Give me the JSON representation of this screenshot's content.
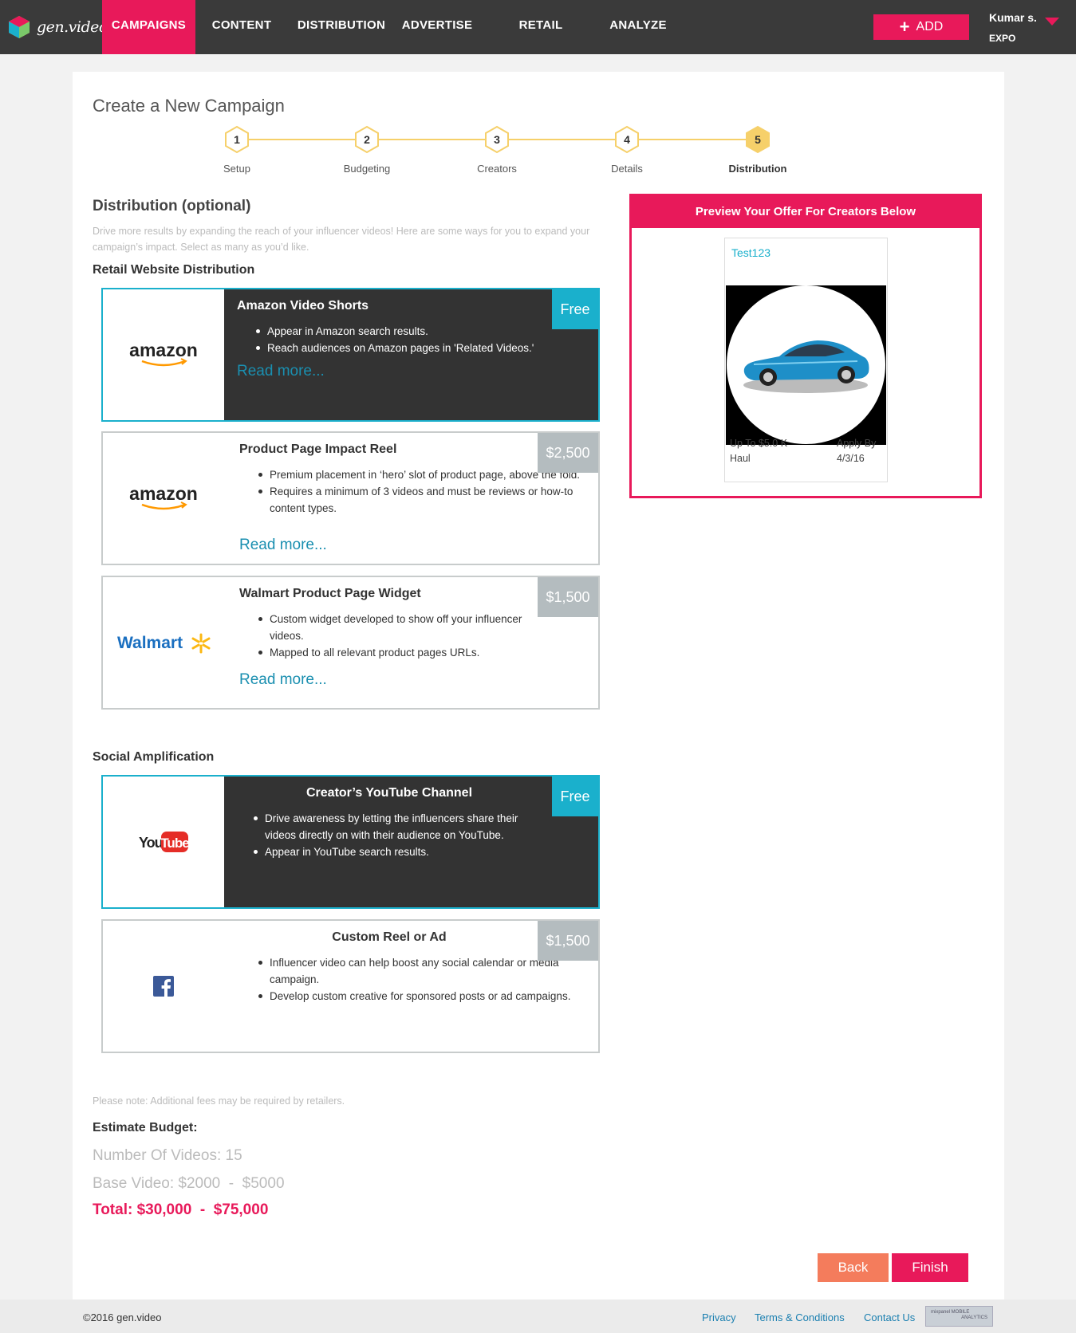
{
  "nav": {
    "logo_text": "gen.video",
    "items": [
      "CAMPAIGNS",
      "CONTENT",
      "DISTRIBUTION",
      "ADVERTISE",
      "RETAIL",
      "ANALYZE"
    ],
    "add_label": "ADD",
    "user_name": "Kumar s.",
    "user_org": "EXPO",
    "accent_color": "#e8195a"
  },
  "page": {
    "title": "Create a New Campaign",
    "steps": [
      {
        "num": "1",
        "label": "Setup"
      },
      {
        "num": "2",
        "label": "Budgeting"
      },
      {
        "num": "3",
        "label": "Creators"
      },
      {
        "num": "4",
        "label": "Details"
      },
      {
        "num": "5",
        "label": "Distribution"
      }
    ],
    "current_step": 5
  },
  "distribution": {
    "title": "Distribution (optional)",
    "intro": "Drive more results by expanding the reach of your influencer videos! Here are some ways for you to expand your campaign’s impact. Select as many as you’d like.",
    "retail_heading": "Retail Website Distribution",
    "social_heading": "Social Amplification",
    "cards": [
      {
        "logo": "amazon",
        "title": "Amazon Video Shorts",
        "price": "Free",
        "selected": true,
        "bullets": [
          "Appear in Amazon search results.",
          "Reach audiences on Amazon pages in 'Related Videos.'"
        ],
        "readmore": "Read more..."
      },
      {
        "logo": "amazon",
        "title": "Product Page Impact Reel",
        "price": "$2,500",
        "selected": false,
        "bullets": [
          "Premium placement in ‘hero’ slot of product page, above the fold.",
          "Requires a minimum of 3 videos and must be reviews or how-to content types."
        ],
        "readmore": "Read more..."
      },
      {
        "logo": "Walmart",
        "title": "Walmart Product Page Widget",
        "price": "$1,500",
        "selected": false,
        "bullets": [
          "Custom widget developed to show off your influencer videos.",
          "Mapped to all relevant product pages URLs."
        ],
        "readmore": "Read more..."
      },
      {
        "logo": "YouTube",
        "title": "Creator’s YouTube Channel",
        "price": "Free",
        "selected": true,
        "bullets": [
          "Drive awareness by letting the influencers share their videos directly on with their audience on YouTube.",
          "Appear in YouTube search results."
        ],
        "readmore": ""
      },
      {
        "logo": "facebook",
        "title": "Custom Reel or Ad",
        "price": "$1,500",
        "selected": false,
        "bullets": [
          "Influencer video can help boost any social calendar or media campaign.",
          "Develop custom creative for sponsored posts or ad campaigns."
        ],
        "readmore": ""
      }
    ],
    "note": "Please note: Additional fees may be required by retailers."
  },
  "budget": {
    "title": "Estimate Budget:",
    "videos": "Number Of Videos: 15",
    "base": "Base Video: $2000  -  $5000",
    "total": "Total: $30,000  -  $75,000"
  },
  "buttons": {
    "back": "Back",
    "finish": "Finish"
  },
  "preview": {
    "header": "Preview Your Offer For Creators Below",
    "offer_name": "Test123",
    "amount": "Up To $5.0 K",
    "apply_label": "Apply By",
    "type": "Haul",
    "apply_date": "4/3/16"
  },
  "footer": {
    "copyright": "©2016 gen.video",
    "links": [
      "Privacy",
      "Terms & Conditions",
      "Contact Us"
    ],
    "badge_line1": "mixpanel MOBILE",
    "badge_line2": "ANALYTICS"
  }
}
